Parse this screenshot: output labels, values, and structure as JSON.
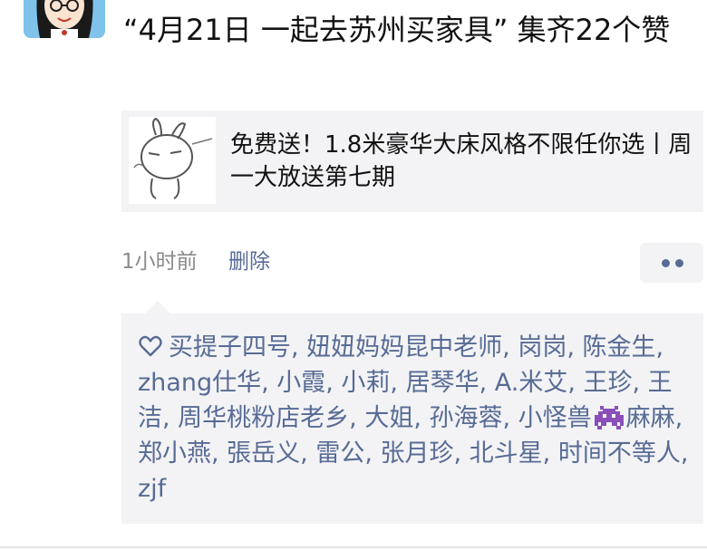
{
  "post": {
    "title": "“4月21日 一起去苏州买家具” 集齐22个赞",
    "time": "1小时前",
    "delete_label": "删除"
  },
  "link_card": {
    "title": "免费送！1.8米豪华大床风格不限任你选丨周一大放送第七期"
  },
  "likes": {
    "before_emoji": "买提子四号, 妞妞妈妈昆中老师, 岗岗, 陈金生, zhang仕华, 小霞, 小莉, 居琴华, A.米艾, 王珍, 王洁, 周华桃粉店老乡, 大姐, 孙海蓉, 小怪兽",
    "after_emoji": "麻麻, 郑小燕, 張岳义, 雷公, 张月珍, 北斗星, 时间不等人, zjf"
  },
  "icons": {
    "heart": "heart-outline-icon",
    "more": "more-dots-icon",
    "emoji": "alien-monster-emoji-icon"
  },
  "colors": {
    "link_blue": "#576b95",
    "card_bg": "#f3f3f5",
    "time_gray": "#8a8a8a",
    "alien_purple": "#8a4fb8"
  }
}
